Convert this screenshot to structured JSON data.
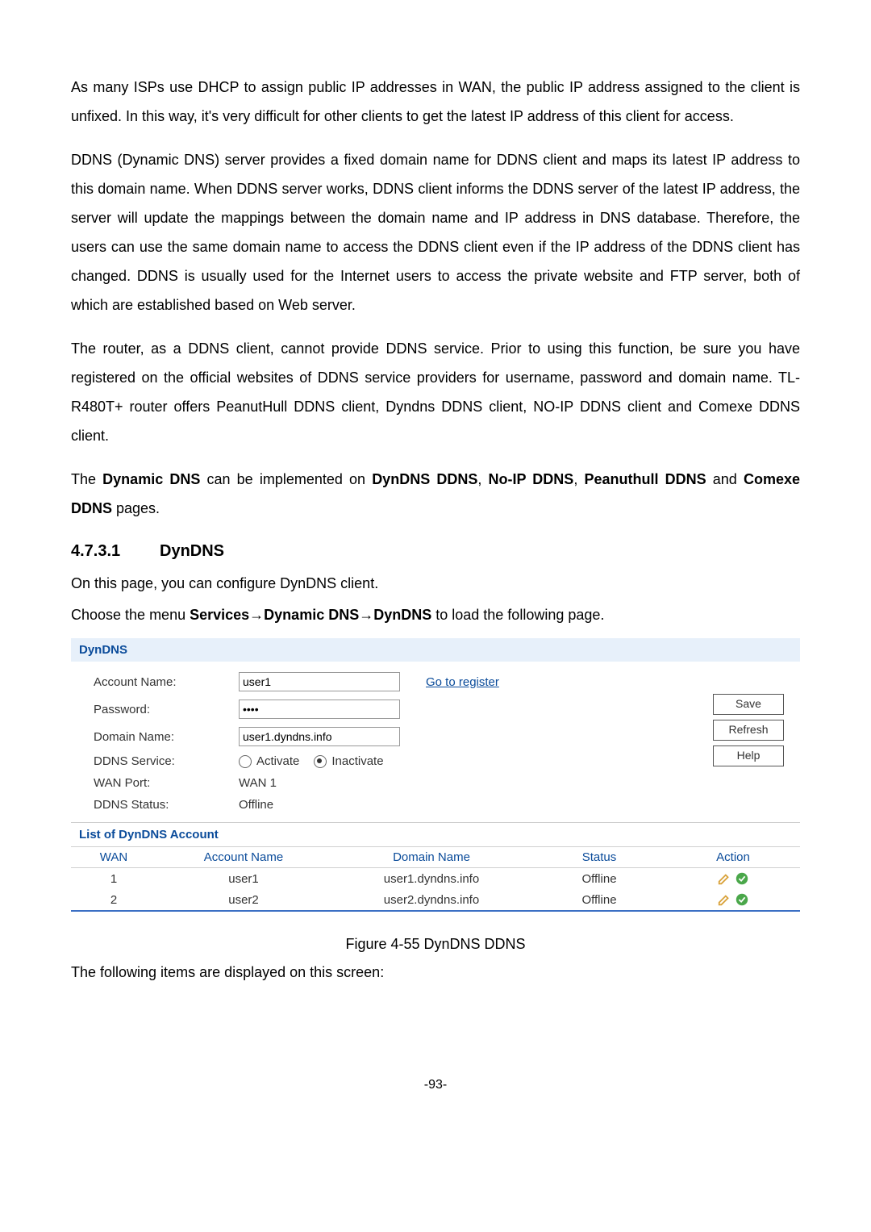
{
  "intro": {
    "p1": "As many ISPs use DHCP to assign public IP addresses in WAN, the public IP address assigned to the client is unfixed. In this way, it's very difficult for other clients to get the latest IP address of this client for access.",
    "p2": "DDNS (Dynamic DNS) server provides a fixed domain name for DDNS client and maps its latest IP address to this domain name. When DDNS server works, DDNS client informs the DDNS server of the latest IP address, the server will update the mappings between the domain name and IP address in DNS database. Therefore, the users can use the same domain name to access the DDNS client even if the IP address of the DDNS client has changed. DDNS is usually used for the Internet users to access the private website and FTP server, both of which are established based on Web server.",
    "p3": "The router, as a DDNS client, cannot provide DDNS service. Prior to using this function, be sure you have registered on the official websites of DDNS service providers for username, password and domain name. TL-R480T+ router offers PeanutHull DDNS client, Dyndns DDNS client, NO-IP DDNS client and Comexe DDNS client.",
    "p4_pre": "The ",
    "p4_b1": "Dynamic DNS",
    "p4_mid1": " can be implemented on ",
    "p4_b2": "DynDNS DDNS",
    "p4_sep": ", ",
    "p4_b3": "No-IP DDNS",
    "p4_b4": "Peanuthull DDNS",
    "p4_mid2": " and ",
    "p4_b5": "Comexe DDNS",
    "p4_post": " pages."
  },
  "section": {
    "number": "4.7.3.1",
    "title": "DynDNS",
    "line1": "On this page, you can configure DynDNS client.",
    "line2_pre": "Choose the menu ",
    "line2_b1": "Services",
    "line2_arrow": "→",
    "line2_b2": "Dynamic DNS",
    "line2_b3": "DynDNS",
    "line2_post": " to load the following page."
  },
  "panel": {
    "title": "DynDNS",
    "labels": {
      "account": "Account Name:",
      "password": "Password:",
      "domain": "Domain Name:",
      "service": "DDNS Service:",
      "wanport": "WAN Port:",
      "status": "DDNS Status:"
    },
    "values": {
      "account": "user1",
      "password": "••••",
      "domain": "user1.dyndns.info",
      "activate": "Activate",
      "inactivate": "Inactivate",
      "wanport": "WAN 1",
      "status": "Offline"
    },
    "register_link": "Go to register",
    "buttons": {
      "save": "Save",
      "refresh": "Refresh",
      "help": "Help"
    },
    "list_title": "List of DynDNS Account",
    "columns": {
      "wan": "WAN",
      "account": "Account Name",
      "domain": "Domain Name",
      "status": "Status",
      "action": "Action"
    },
    "rows": [
      {
        "wan": "1",
        "account": "user1",
        "domain": "user1.dyndns.info",
        "status": "Offline"
      },
      {
        "wan": "2",
        "account": "user2",
        "domain": "user2.dyndns.info",
        "status": "Offline"
      }
    ]
  },
  "figure_caption": "Figure 4-55 DynDNS DDNS",
  "following_items": "The following items are displayed on this screen:",
  "page_number": "-93-"
}
